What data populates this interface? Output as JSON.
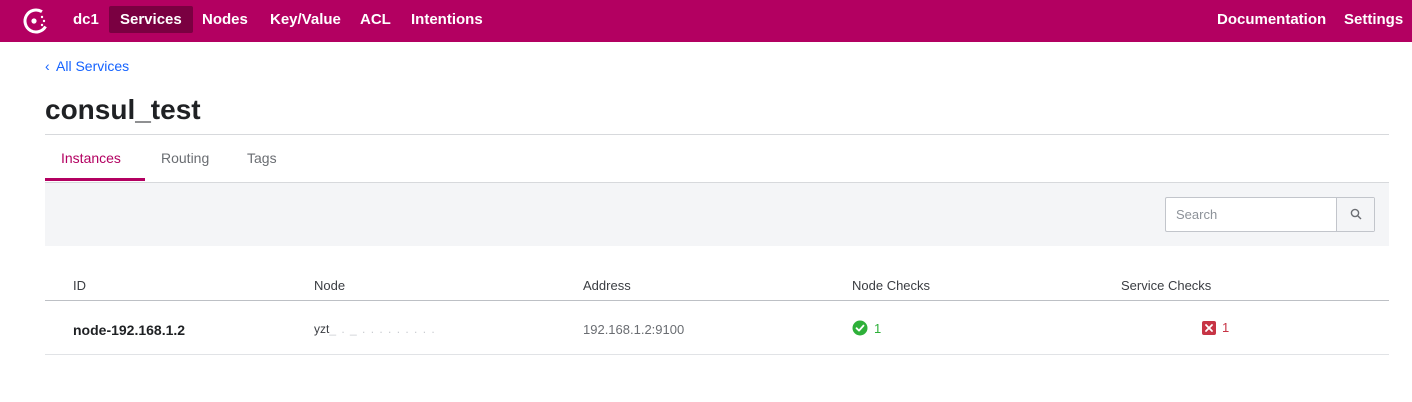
{
  "nav": {
    "datacenter": "dc1",
    "items": [
      {
        "label": "Services",
        "active": true
      },
      {
        "label": "Nodes"
      },
      {
        "label": "Key/Value"
      },
      {
        "label": "ACL"
      },
      {
        "label": "Intentions"
      }
    ],
    "right": [
      "Documentation",
      "Settings"
    ]
  },
  "breadcrumb": {
    "label": "All Services"
  },
  "page": {
    "title": "consul_test"
  },
  "tabs": [
    {
      "label": "Instances",
      "active": true
    },
    {
      "label": "Routing"
    },
    {
      "label": "Tags"
    }
  ],
  "search": {
    "placeholder": "Search",
    "value": ""
  },
  "table": {
    "columns": [
      "ID",
      "Node",
      "Address",
      "Node Checks",
      "Service Checks"
    ],
    "rows": [
      {
        "id": "node-192.168.1.2",
        "node": "yzt",
        "address": "192.168.1.2:9100",
        "node_checks": {
          "status": "passing",
          "count": "1"
        },
        "service_checks": {
          "status": "critical",
          "count": "1"
        }
      }
    ]
  },
  "colors": {
    "brand": "#b30061",
    "brand_dark": "#7a0041",
    "link": "#1563ff",
    "passing": "#2eb039",
    "critical": "#c73445"
  },
  "icons": {
    "logo": "consul-logo-icon",
    "back": "chevron-left-icon",
    "search": "search-icon",
    "passing": "check-circle-icon",
    "critical": "x-square-icon"
  }
}
